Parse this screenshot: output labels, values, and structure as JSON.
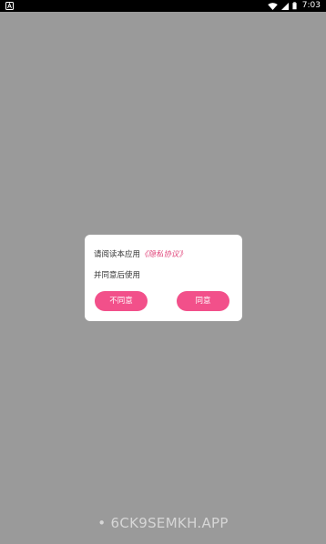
{
  "status_bar": {
    "time": "7:03"
  },
  "dialog": {
    "prefix_text": "请阅读本应用",
    "policy_link": "《隐私协议》",
    "line2": "并同意后使用",
    "disagree_label": "不同意",
    "agree_label": "同意"
  },
  "watermark": {
    "text": "• 6CK9SEMKH.APP"
  },
  "colors": {
    "overlay_bg": "#9a9a9a",
    "accent": "#f2508a",
    "link": "#e0457a"
  }
}
